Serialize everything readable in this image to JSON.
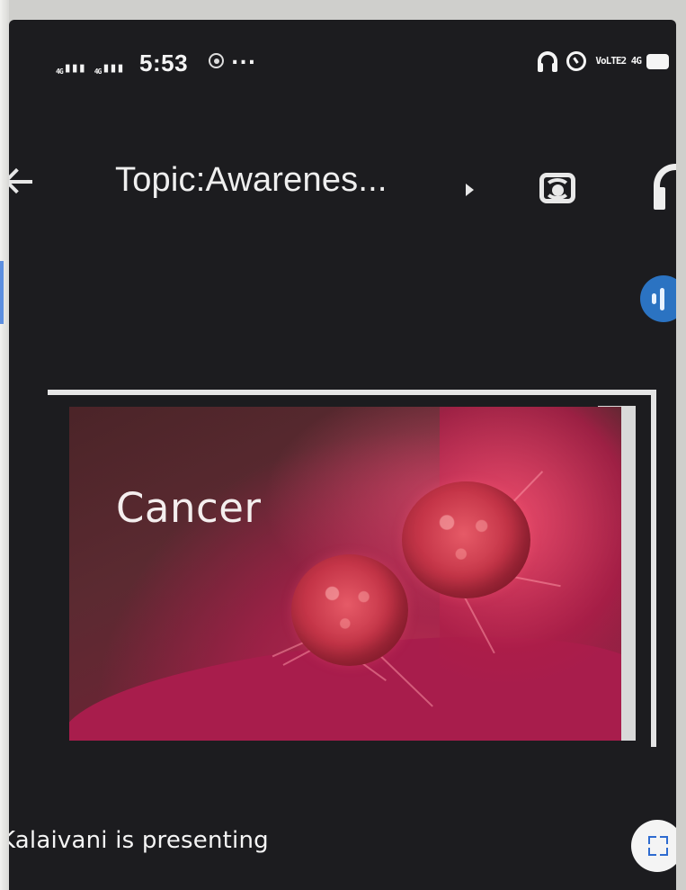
{
  "status_bar": {
    "left_signal_labels": [
      "4G",
      "4G"
    ],
    "time": "5:53",
    "overflow_dots": "...",
    "network_label": "VoLTE2 4G"
  },
  "meeting": {
    "title": "Topic:Awarenes..."
  },
  "slide": {
    "title": "Cancer"
  },
  "bottom": {
    "presenter_text": "Kalaivani is presenting"
  },
  "icons": {
    "back": "back-arrow-icon",
    "expand_title": "chevron-right-icon",
    "switch_camera": "switch-camera-icon",
    "audio_output": "headphones-icon",
    "active_speaker": "audio-level-icon",
    "fullscreen": "fullscreen-icon"
  },
  "colors": {
    "screen_background": "#1c1c1f",
    "slide_accent": "#a81d4c",
    "speaker_blue": "#2b73c2"
  }
}
